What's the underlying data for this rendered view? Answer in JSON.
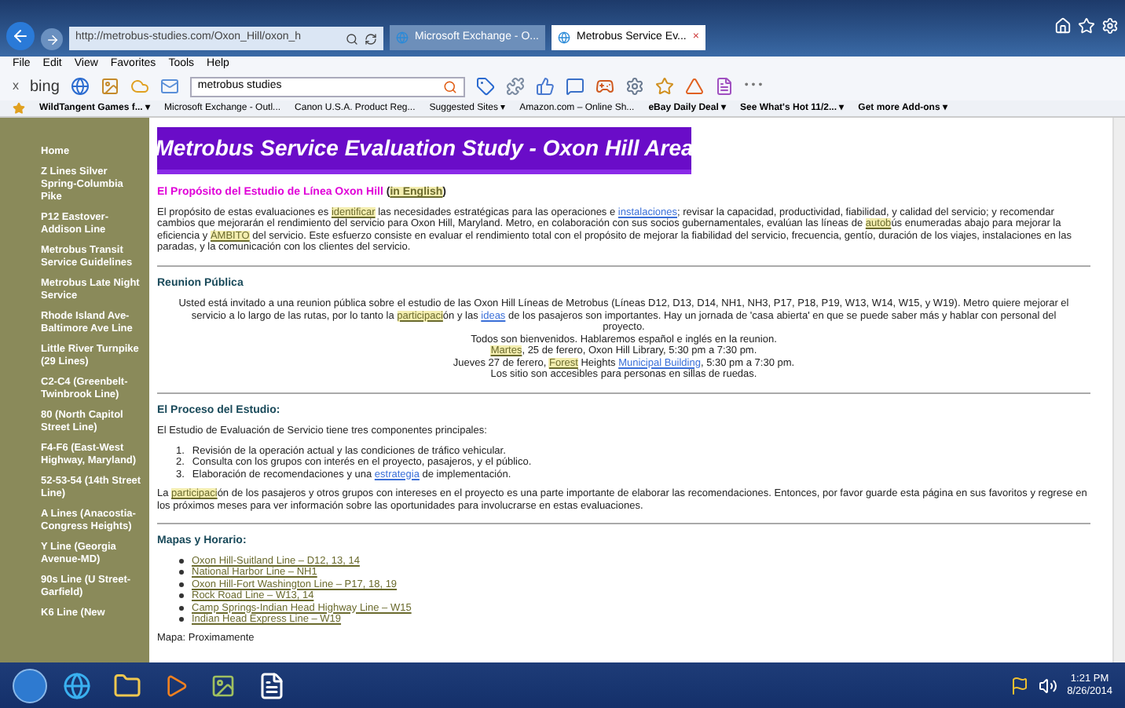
{
  "browser": {
    "address": "http://metrobus-studies.com/Oxon_Hill/oxon_h",
    "tabs": [
      {
        "label": "Microsoft Exchange - O...",
        "selected": false
      },
      {
        "label": "Metrobus Service Ev...",
        "selected": true
      }
    ],
    "tab_close": "×",
    "menu": [
      "File",
      "Edit",
      "View",
      "Favorites",
      "Tools",
      "Help"
    ],
    "close_toolbar": "x",
    "search_brand": "bing",
    "search_value": "metrobus studies",
    "more": "• • •",
    "favorites": [
      "WildTangent Games f... ▾",
      "Microsoft Exchange - Outl...",
      "Canon U.S.A. Product Reg...",
      "Suggested Sites ▾",
      "Amazon.com – Online Sh...",
      "eBay Daily Deal ▾",
      "See What's Hot 11/2... ▾",
      "Get more Add-ons ▾"
    ]
  },
  "sidebar": {
    "items": [
      "Home",
      "Z Lines Silver Spring-Columbia Pike",
      "P12 Eastover-Addison Line",
      "Metrobus Transit Service Guidelines",
      "Metrobus Late Night Service",
      "Rhode Island Ave-Baltimore Ave Line",
      "Little River Turnpike (29 Lines)",
      "C2-C4 (Greenbelt-Twinbrook Line)",
      "80 (North Capitol Street Line)",
      "F4-F6 (East-West Highway, Maryland)",
      "52-53-54 (14th Street Line)",
      "A Lines (Anacostia-Congress Heights)",
      "Y Line (Georgia Avenue-MD)",
      "90s Line (U Street-Garfield)",
      "K6 Line (New"
    ]
  },
  "banner": "Metrobus Service Evaluation Study - Oxon Hill Area",
  "purpose": {
    "title": [
      {
        "kind": "title",
        "text": "El Propósito del Estudio de Línea Oxon Hill"
      },
      {
        "kind": "text",
        "text": " ("
      },
      {
        "kind": "hl",
        "text": "in English"
      },
      {
        "kind": "text",
        "text": ")"
      }
    ],
    "paragraph": [
      {
        "kind": "text",
        "text": "El propósito de estas evaluaciones es "
      },
      {
        "kind": "hl",
        "text": "identificar"
      },
      {
        "kind": "text",
        "text": " las necesidades estratégicas para las operaciones e "
      },
      {
        "kind": "link",
        "text": "instalaciones"
      },
      {
        "kind": "text",
        "text": "; revisar la capacidad, productividad, fiabilidad, y calidad del servicio; y recomendar cambios que mejorarán el rendimiento del servicio para Oxon Hill, Maryland. Metro, en colaboración con sus socios gubernamentales, evalúan las líneas de "
      },
      {
        "kind": "hl",
        "text": "autob"
      },
      {
        "kind": "text",
        "text": "ús enumeradas abajo para mejorar la eficiencia y "
      },
      {
        "kind": "hl",
        "text": "ÁMBITO"
      },
      {
        "kind": "text",
        "text": " del servicio. Este esfuerzo consiste en evaluar el rendimiento total con el propósito de mejorar la fiabilidad del servicio, frecuencia, gentío, duración de los viajes, instalaciones en las paradas, y la comunicación con los clientes del servicio."
      }
    ]
  },
  "meeting": {
    "heading": "Reunion Pública",
    "lines": [
      [
        {
          "kind": "text",
          "text": "Usted está invitado a una reunion pública sobre el estudio de las Oxon Hill Líneas de Metrobus (Líneas D12, D13, D14, NH1, NH3, P17, P18, P19, W13, W14, W15, y W19). Metro quiere mejorar el servicio a lo largo de las rutas, por lo tanto la "
        },
        {
          "kind": "hl",
          "text": "participaci"
        },
        {
          "kind": "text",
          "text": "ón y las "
        },
        {
          "kind": "link",
          "text": "ideas"
        },
        {
          "kind": "text",
          "text": " de los pasajeros son importantes. Hay un jornada de 'casa abierta' en que se puede saber más y hablar con personal del proyecto."
        }
      ],
      [
        {
          "kind": "text",
          "text": "Todos son bienvenidos. Hablaremos español e inglés en la reunion."
        }
      ],
      [
        {
          "kind": "hl",
          "text": "Martes"
        },
        {
          "kind": "text",
          "text": ", 25 de ferero, Oxon Hill Library, 5:30 pm a 7:30 pm."
        }
      ],
      [
        {
          "kind": "text",
          "text": "Jueves 27 de ferero, "
        },
        {
          "kind": "hl",
          "text": "Forest"
        },
        {
          "kind": "text",
          "text": " Heights "
        },
        {
          "kind": "link",
          "text": "Municipal Building"
        },
        {
          "kind": "text",
          "text": ", 5:30 pm a 7:30 pm."
        }
      ],
      [
        {
          "kind": "text",
          "text": "Los sitio son accesibles para personas en sillas de ruedas."
        }
      ]
    ]
  },
  "process": {
    "heading": "El Proceso del Estudio:",
    "intro": "El Estudio de Evaluación de Servicio tiene tres componentes principales:",
    "steps": [
      {
        "number": "1.",
        "parts": [
          {
            "kind": "text",
            "text": "Revisión de la operación actual y las condiciones de tráfico vehicular."
          }
        ]
      },
      {
        "number": "2.",
        "parts": [
          {
            "kind": "text",
            "text": "Consulta con los grupos con interés en el proyecto, pasajeros, y el público."
          }
        ]
      },
      {
        "number": "3.",
        "parts": [
          {
            "kind": "text",
            "text": "Elaboración de recomendaciones y una "
          },
          {
            "kind": "link",
            "text": "estrategia"
          },
          {
            "kind": "text",
            "text": " de implementación."
          }
        ]
      }
    ],
    "paragraph": [
      {
        "kind": "text",
        "text": "La "
      },
      {
        "kind": "hl",
        "text": "participaci"
      },
      {
        "kind": "text",
        "text": "ón de los pasajeros y otros grupos con intereses en el proyecto es una parte importante de elaborar las recomendaciones. Entonces, por favor guarde esta página en sus favoritos y regrese en los próximos meses para ver información sobre las oportunidades para involucrarse en estas evaluaciones."
      }
    ]
  },
  "maps": {
    "heading": "Mapas y Horario:",
    "links": [
      "Oxon Hill-Suitland Line – D12, 13, 14",
      "National Harbor Line – NH1",
      "Oxon Hill-Fort Washington Line – P17, 18, 19",
      "Rock Road Line – W13, 14",
      "Camp Springs-Indian Head Highway Line – W15",
      "Indian Head Express Line – W19"
    ],
    "note": "Mapa: Proximamente"
  },
  "taskbar": {
    "time": "1:21 PM",
    "date": "8/26/2014"
  }
}
